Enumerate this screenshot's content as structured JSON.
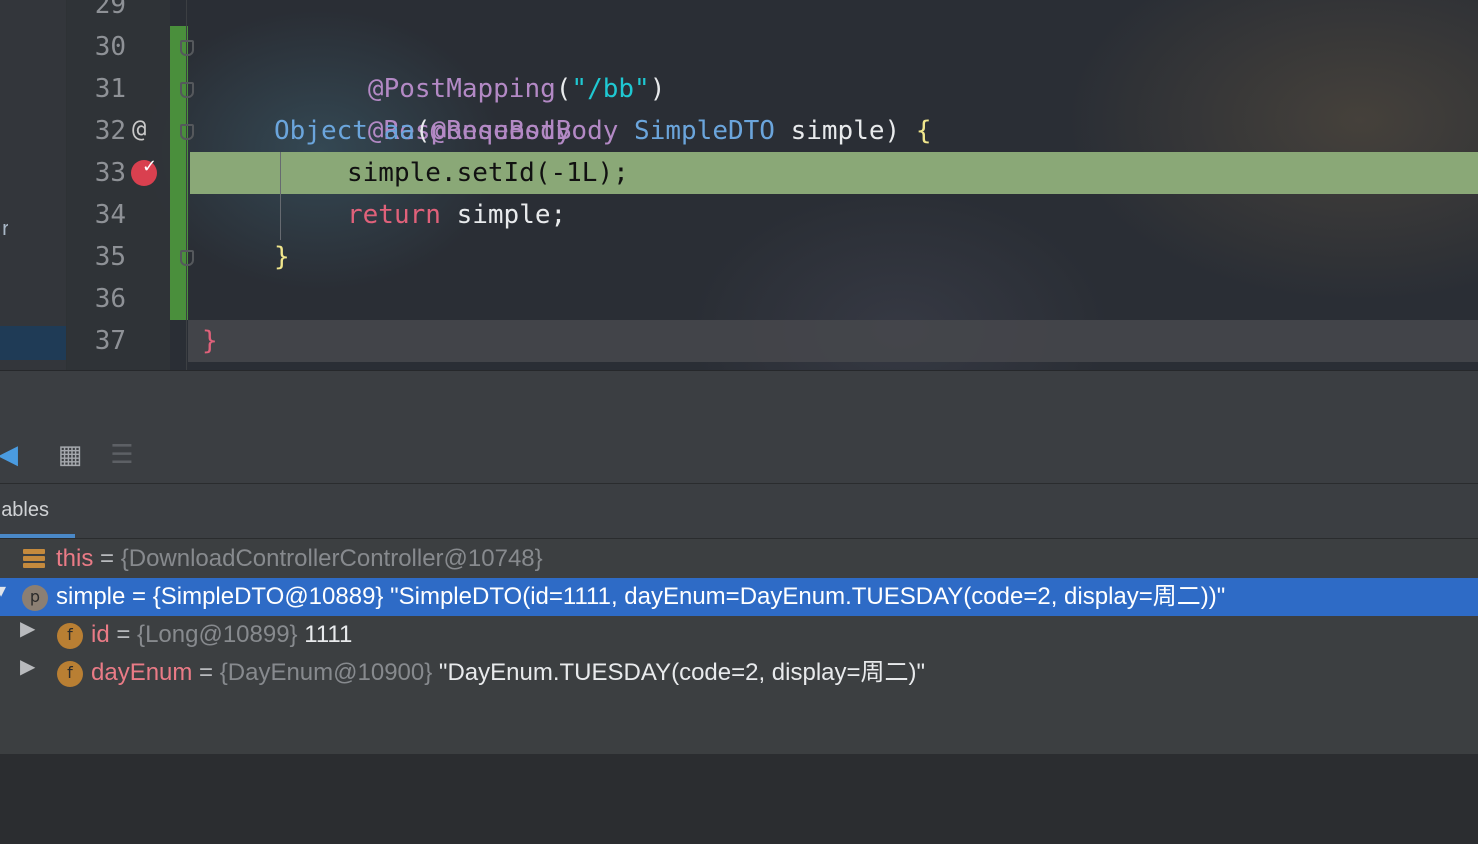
{
  "editor": {
    "line_numbers": [
      "29",
      "30",
      "31",
      "32",
      "33",
      "34",
      "35",
      "36",
      "37"
    ],
    "gutter_marker": "@",
    "code": {
      "l30_ann": "@PostMapping",
      "l30_open": "(",
      "l30_str": "\"/bb\"",
      "l30_close": ")",
      "l31_ann": "@ResponseBody",
      "l32_type": "Object",
      "l32_method": "aa",
      "l32_open": "(",
      "l32_ann": "@RequestBody",
      "l32_dto": "SimpleDTO",
      "l32_param": "simple",
      "l32_close": ")",
      "l32_brace": "{",
      "l33": "simple.setId(-1L);",
      "l34_kw": "return",
      "l34_rest": "simple;",
      "l35_brace": "}",
      "l37_brace": "}"
    }
  },
  "left_panel": {
    "fragment": "r"
  },
  "debug": {
    "tab_label": "ables",
    "variables": [
      {
        "name": "this",
        "eq": " = ",
        "type": "{DownloadControllerController@10748}",
        "value": ""
      },
      {
        "name": "simple",
        "eq": " = ",
        "type": "{SimpleDTO@10889}",
        "value": " \"SimpleDTO(id=1111, dayEnum=DayEnum.TUESDAY(code=2, display=周二))\""
      },
      {
        "name": "id",
        "eq": " = ",
        "type": "{Long@10899}",
        "value": " 1111"
      },
      {
        "name": "dayEnum",
        "eq": " = ",
        "type": "{DayEnum@10900}",
        "value": " \"DayEnum.TUESDAY(code=2, display=周二)\""
      }
    ],
    "badges": {
      "p": "p",
      "f": "f"
    }
  },
  "colors": {
    "exec_line": "#8aa877",
    "selection": "#2e6bc6",
    "breakpoint": "#d9404f"
  }
}
